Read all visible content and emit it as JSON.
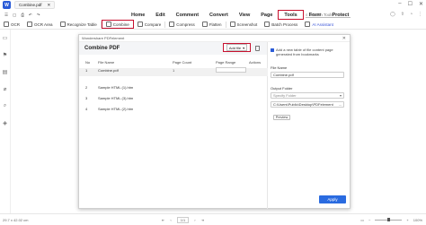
{
  "app": {
    "title": "Combine.pdf",
    "logo_char": "W"
  },
  "menu": {
    "items": [
      "Home",
      "Edit",
      "Comment",
      "Convert",
      "View",
      "Page",
      "Tools",
      "Form",
      "Protect"
    ],
    "active": "Tools",
    "search_placeholder": "Search Tools"
  },
  "toolbar": {
    "items": [
      "OCR",
      "OCR Area",
      "Recognize Table",
      "Combine",
      "Compare",
      "Compress",
      "Flatten",
      "Screenshot",
      "Batch Process",
      "AI Assistant"
    ],
    "active": "Combine"
  },
  "dialog": {
    "title": "Wondershare PDFelement",
    "close": "✕",
    "heading": "Combine PDF",
    "add_files_label": "Add file",
    "add_files_arrow": "▾",
    "columns": {
      "no": "No",
      "filename": "File Name",
      "page_count": "Page Count",
      "page_range": "Page Range",
      "actions": "Actions"
    },
    "rows": [
      {
        "no": "1",
        "fname": "Combine.pdf",
        "count": "1"
      },
      {
        "no": "2",
        "fname": "Sample HTML (1).htm",
        "count": ""
      },
      {
        "no": "3",
        "fname": "Sample HTML (3).htm",
        "count": ""
      },
      {
        "no": "4",
        "fname": "Sample HTML (2).htm",
        "count": ""
      }
    ],
    "checkbox_text": "Add a new table of file content page generated from bookmarks",
    "file_name_label": "File Name",
    "file_name_value": "Combine.pdf",
    "output_folder_label": "Output Folder",
    "output_folder_select": "Specify Folder",
    "output_path": "C:\\Users\\Public\\Desktop\\PDFelement",
    "output_path_btn": "...",
    "preview_label": "Preview",
    "apply_label": "Apply"
  },
  "status": {
    "dims": "29.7 x 42.02 cm",
    "page": "1/1",
    "zoom": "100%"
  }
}
